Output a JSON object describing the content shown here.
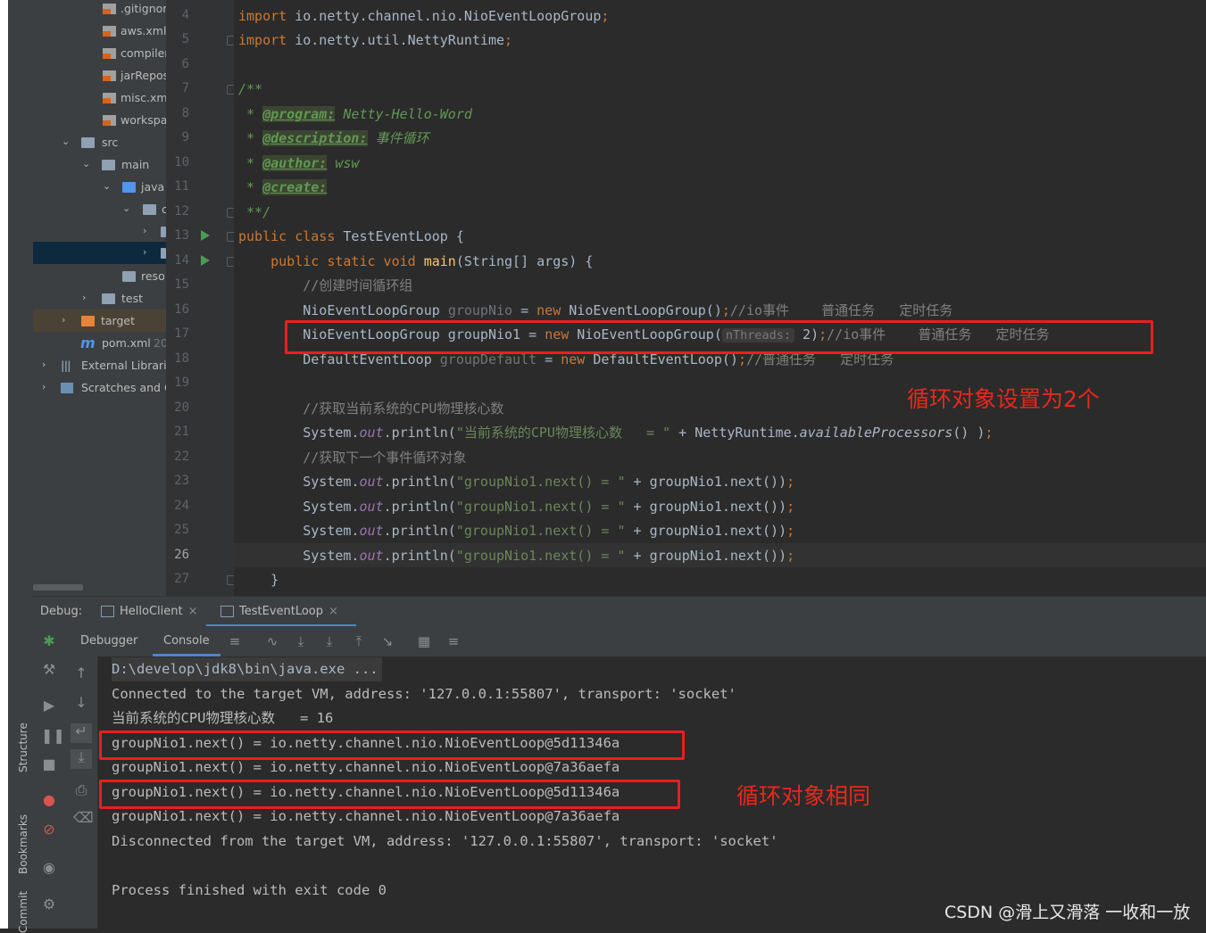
{
  "project_tree": {
    "items": [
      {
        "label": ".gitignor",
        "icon": "gitignore-file-icon"
      },
      {
        "label": "aws.xml",
        "icon": "xml-file-icon"
      },
      {
        "label": "compiler",
        "icon": "xml-file-icon"
      },
      {
        "label": "jarRepos",
        "icon": "xml-file-icon"
      },
      {
        "label": "misc.xml",
        "icon": "xml-file-icon"
      },
      {
        "label": "workspa",
        "icon": "xml-file-icon"
      },
      {
        "label": "src",
        "icon": "folder-icon"
      },
      {
        "label": "main",
        "icon": "folder-icon"
      },
      {
        "label": "java",
        "icon": "source-folder-icon"
      },
      {
        "label": "c",
        "icon": "package-icon"
      },
      {
        "label": "",
        "icon": "package-icon"
      },
      {
        "label": "",
        "icon": "package-icon"
      },
      {
        "label": "reso",
        "icon": "resources-folder-icon"
      },
      {
        "label": "test",
        "icon": "folder-icon"
      },
      {
        "label": "target",
        "icon": "target-folder-icon"
      },
      {
        "label": "pom.xml",
        "icon": "maven-icon",
        "suffix": "20"
      },
      {
        "label": "External Librarie",
        "icon": "library-icon"
      },
      {
        "label": "Scratches and C",
        "icon": "scratches-icon"
      }
    ]
  },
  "editor": {
    "line_numbers": [
      "4",
      "5",
      "6",
      "7",
      "8",
      "9",
      "10",
      "11",
      "12",
      "13",
      "14",
      "15",
      "16",
      "17",
      "18",
      "19",
      "20",
      "21",
      "22",
      "23",
      "24",
      "25",
      "26",
      "27"
    ],
    "current_line": "26",
    "lines": {
      "l4": {
        "kw": "import",
        "rest": " io.netty.channel.nio.NioEventLoopGroup",
        "semi": ";"
      },
      "l5": {
        "kw": "import",
        "rest": " io.netty.util.NettyRuntime",
        "semi": ";"
      },
      "l7": "/**",
      "l8": {
        "star": " * ",
        "tag": "@program:",
        "text": " Netty-Hello-Word"
      },
      "l9": {
        "star": " * ",
        "tag": "@description:",
        "text": " 事件循环"
      },
      "l10": {
        "star": " * ",
        "tag": "@author:",
        "text": " wsw"
      },
      "l11": {
        "star": " * ",
        "tag": "@create:"
      },
      "l12": " **/",
      "l13": {
        "kw": "public class",
        "name": " TestEventLoop {"
      },
      "l14": {
        "indent": "    ",
        "kw": "public static void",
        "method": " main",
        "rest": "(String[] args) {"
      },
      "l15": {
        "indent": "        ",
        "comment": "//创建时间循环组"
      },
      "l16": {
        "indent": "        ",
        "type": "NioEventLoopGroup ",
        "var": "groupNio",
        "eq": " = ",
        "kw": "new",
        "call": " NioEventLoopGroup()",
        "semi": ";",
        "comment": "//io事件    普通任务   定时任务"
      },
      "l17": {
        "indent": "        ",
        "type": "NioEventLoopGroup groupNio1 = ",
        "kw": "new",
        "call": " NioEventLoopGroup(",
        "hint": "nThreads:",
        "arg": " 2)",
        "semi": ";",
        "comment": "//io事件    普通任务   定时任务"
      },
      "l18": {
        "indent": "        ",
        "type": "DefaultEventLoop ",
        "var": "groupDefault",
        "eq": " = ",
        "kw": "new",
        "call": " DefaultEventLoop()",
        "semi": ";",
        "comment": "//普通任务   定时任务"
      },
      "l20": {
        "indent": "        ",
        "comment": "//获取当前系统的CPU物理核心数"
      },
      "l21": {
        "indent": "        ",
        "pre": "System.",
        "field": "out",
        "mid": ".println(",
        "str": "\"当前系统的CPU物理核心数   = \"",
        "post": " + NettyRuntime.",
        "static": "availableProcessors",
        "end": "() )",
        "semi": ";"
      },
      "l22": {
        "indent": "        ",
        "comment": "//获取下一个事件循环对象"
      },
      "println_next": {
        "indent": "        ",
        "pre": "System.",
        "field": "out",
        "mid": ".println(",
        "str": "\"groupNio1.next() = \"",
        "post": " + groupNio1.next())",
        "semi": ";"
      },
      "l27": "    }"
    }
  },
  "annotations": {
    "editor_note": "循环对象设置为2个",
    "console_note": "循环对象相同"
  },
  "debug_panel": {
    "label": "Debug:",
    "tabs": [
      "HelloClient",
      "TestEventLoop"
    ],
    "active_tab": "TestEventLoop",
    "subtabs": [
      "Debugger",
      "Console"
    ],
    "active_subtab": "Console"
  },
  "console": {
    "lines": [
      "D:\\develop\\jdk8\\bin\\java.exe ...",
      "Connected to the target VM, address: '127.0.0.1:55807', transport: 'socket'",
      "当前系统的CPU物理核心数   = 16",
      "groupNio1.next() = io.netty.channel.nio.NioEventLoop@5d11346a",
      "groupNio1.next() = io.netty.channel.nio.NioEventLoop@7a36aefa",
      "groupNio1.next() = io.netty.channel.nio.NioEventLoop@5d11346a",
      "groupNio1.next() = io.netty.channel.nio.NioEventLoop@7a36aefa",
      "Disconnected from the target VM, address: '127.0.0.1:55807', transport: 'socket'",
      "",
      "Process finished with exit code 0"
    ]
  },
  "side_panels": {
    "structure": "Structure",
    "bookmarks": "Bookmarks",
    "commit": "Commit"
  },
  "watermark": "CSDN @滑上又滑落 一收和一放",
  "colors": {
    "accent_red": "#e8201c",
    "keyword": "#cc7832",
    "string": "#6a8759",
    "doc": "#629755",
    "field": "#9876aa",
    "method": "#ffc66d"
  }
}
